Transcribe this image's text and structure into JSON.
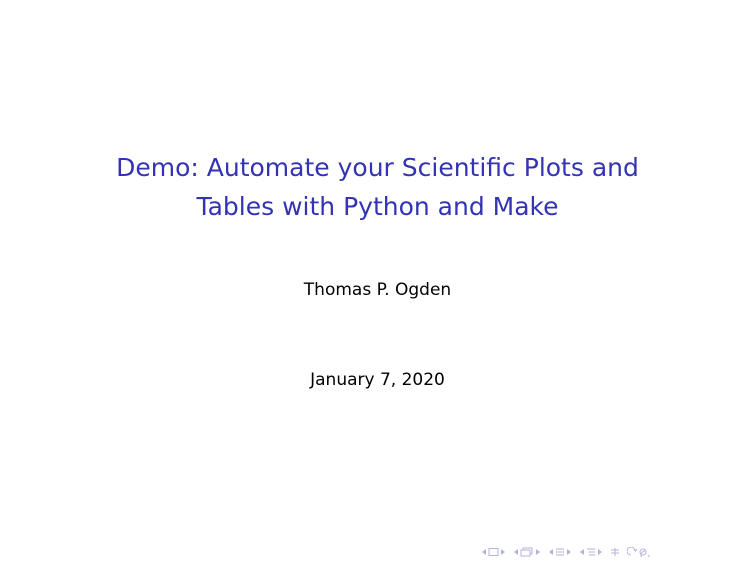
{
  "slide": {
    "title_lines": [
      "Demo: Automate your Scientific Plots and",
      "Tables with Python and Make"
    ],
    "author": "Thomas P. Ogden",
    "date": "January 7, 2020"
  },
  "colors": {
    "title": "#3333b3",
    "text": "#000000",
    "nav": "#b3b3d9"
  },
  "nav_icons": [
    "prev-slide-arrow-icon",
    "slide-icon",
    "next-slide-arrow-icon",
    "prev-frame-arrow-icon",
    "frame-icon",
    "next-frame-arrow-icon",
    "prev-subsection-arrow-icon",
    "subsection-icon",
    "next-subsection-arrow-icon",
    "prev-section-arrow-icon",
    "section-icon",
    "next-section-arrow-icon",
    "appendix-icon",
    "search-icon"
  ]
}
